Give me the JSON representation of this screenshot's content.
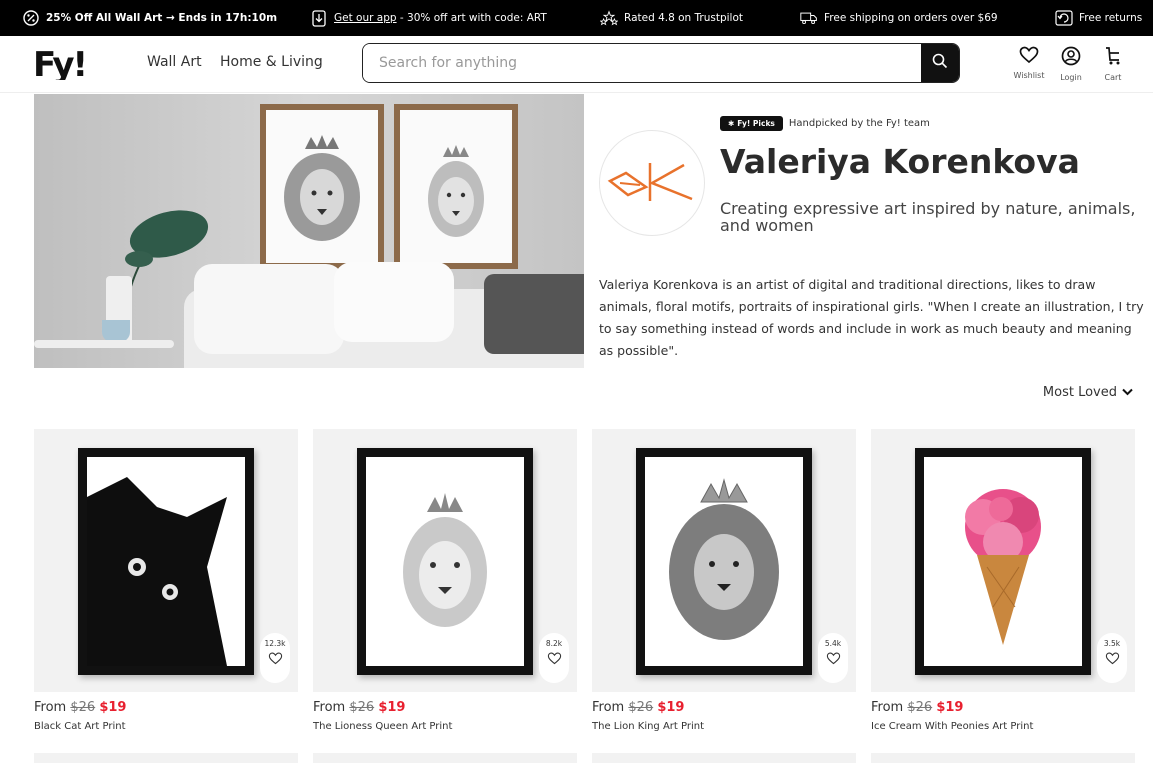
{
  "promo": {
    "sale": "25% Off All Wall Art → Ends in 17h:10m",
    "app_link": "Get our app",
    "app_rest": " - 30% off art with code: ART",
    "rating": "Rated 4.8 on Trustpilot",
    "shipping": "Free shipping on orders over $69",
    "returns": "Free returns"
  },
  "header": {
    "logo_text": "Fy!",
    "nav": [
      "Wall Art",
      "Home & Living"
    ],
    "search_placeholder": "Search for anything",
    "icons": [
      {
        "label": "Wishlist",
        "icon": "heart-icon"
      },
      {
        "label": "Login",
        "icon": "user-icon"
      },
      {
        "label": "Cart",
        "icon": "cart-icon"
      }
    ]
  },
  "artist": {
    "picks_badge": "Fy! Picks",
    "picks_text": "Handpicked by the Fy! team",
    "name": "Valeriya Korenkova",
    "tagline": "Creating expressive art inspired by nature, animals, and women",
    "bio": "Valeriya Korenkova is an artist of digital and traditional directions, likes to draw animals, floral motifs, portraits of inspirational girls. \"When I create an illustration, I try to say something instead of words and include in work as much beauty and meaning as possible\".",
    "logo_color": "#e8722c"
  },
  "sort": {
    "label": "Most Loved"
  },
  "products": [
    {
      "title": "Black Cat Art Print",
      "from": "From ",
      "old_price": "$26",
      "price": "$19",
      "loves": "12.3k"
    },
    {
      "title": "The Lioness Queen Art Print",
      "from": "From ",
      "old_price": "$26",
      "price": "$19",
      "loves": "8.2k"
    },
    {
      "title": "The Lion King Art Print",
      "from": "From ",
      "old_price": "$26",
      "price": "$19",
      "loves": "5.4k"
    },
    {
      "title": "Ice Cream With Peonies Art Print",
      "from": "From ",
      "old_price": "$26",
      "price": "$19",
      "loves": "3.5k"
    }
  ],
  "colors": {
    "sale_red": "#e8202f",
    "brand_black": "#111111"
  }
}
